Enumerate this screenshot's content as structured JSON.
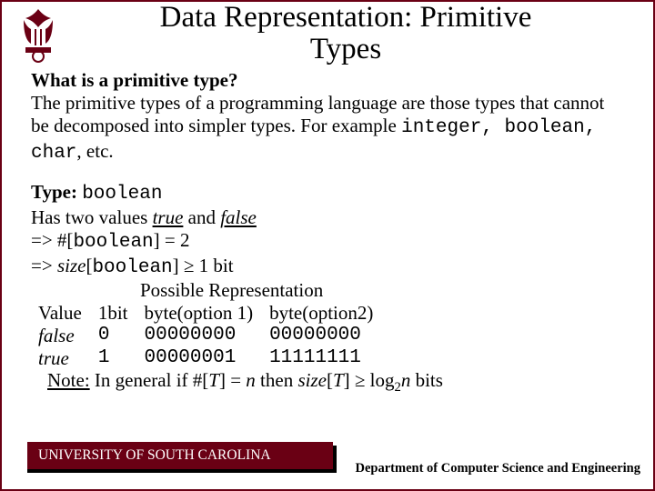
{
  "title_line1": "Data Representation: Primitive",
  "title_line2": "Types",
  "q1": "What is a primitive type?",
  "intro_a": "The primitive types of a programming language are those types that cannot be decomposed into simpler types. For example ",
  "intro_code": "integer, boolean, char",
  "intro_b": ", etc.",
  "type_label": "Type: ",
  "type_name": "boolean",
  "has_a": "Has two values ",
  "has_true": "true",
  "has_and": " and ",
  "has_false": "false",
  "eq1_a": "=> #[",
  "eq1_code": "boolean",
  "eq1_b": "] = 2",
  "eq2_a": "=> ",
  "eq2_size": "size",
  "eq2_b": "[",
  "eq2_code": "boolean",
  "eq2_c": "] ≥ 1 bit",
  "poss_hdr": "Possible Representation",
  "col_value": "Value",
  "col_1bit": "1bit",
  "col_b1": "byte(option 1)",
  "col_b2": "byte(option2)",
  "row_f_v": "false",
  "row_f_1": "0",
  "row_f_b1": "00000000",
  "row_f_b2": "00000000",
  "row_t_v": "true",
  "row_t_1": "1",
  "row_t_b1": "00000001",
  "row_t_b2": "11111111",
  "note_a": "Note:",
  "note_b": " In general  if #[",
  "note_c": "T",
  "note_d": "] = ",
  "note_e": "n",
  "note_f": "  then ",
  "note_g": "size",
  "note_h": "[",
  "note_i": "T",
  "note_j": "] ≥ log",
  "note_k": "2",
  "note_l": "n",
  "note_m": " bits",
  "footer_left": "UNIVERSITY OF SOUTH CAROLINA",
  "footer_right": "Department of Computer Science and Engineering"
}
